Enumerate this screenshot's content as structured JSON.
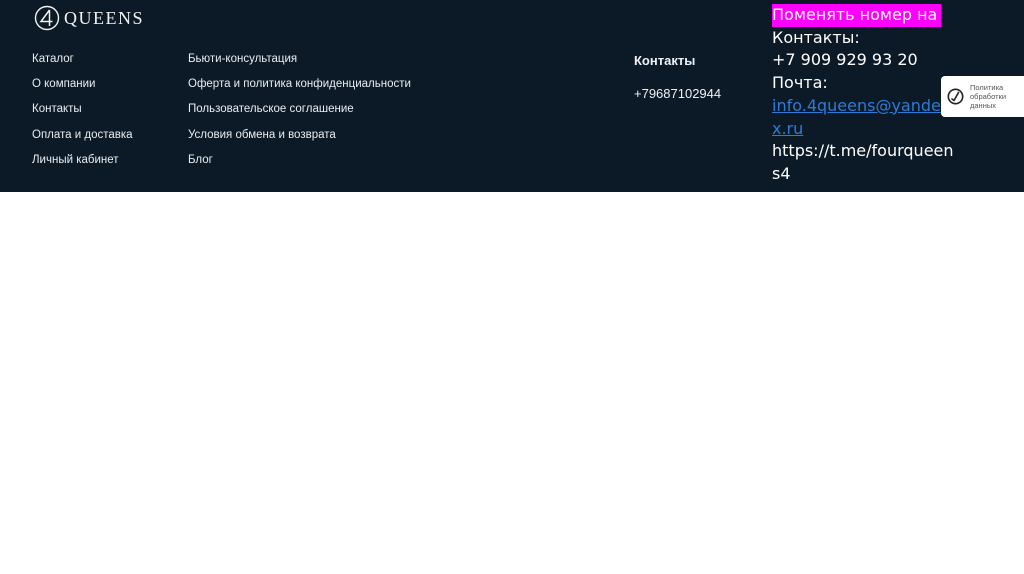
{
  "brand": {
    "logo_icon": "four-circle-logo-icon",
    "name": "QUEENS"
  },
  "menu": {
    "column1": [
      "Каталог",
      "О компании",
      "Контакты",
      "Оплата и доставка",
      "Личный кабинет"
    ],
    "column2": [
      "Бьюти-консультация",
      "Оферта и политика конфиденциальности",
      "Пользовательское соглашение",
      "Условия обмена и возврата",
      "Блог"
    ]
  },
  "contacts": {
    "title": "Контакты",
    "phone": "+79687102944"
  },
  "note": {
    "highlight": "Поменять номер на",
    "contacts_label": "Контакты:",
    "phone": "+7 909 929 93 20",
    "email_label": "Почта:",
    "email": "info.4queens@yandex.ru",
    "telegram": "https://t.me/fourqueens4"
  },
  "policy_badge": {
    "icon": "policy-shield-icon",
    "text": "Политика обработки данных"
  },
  "colors": {
    "footer_bg": "#0c1a27",
    "highlight": "#ff00ff",
    "link": "#2e7bd6"
  }
}
